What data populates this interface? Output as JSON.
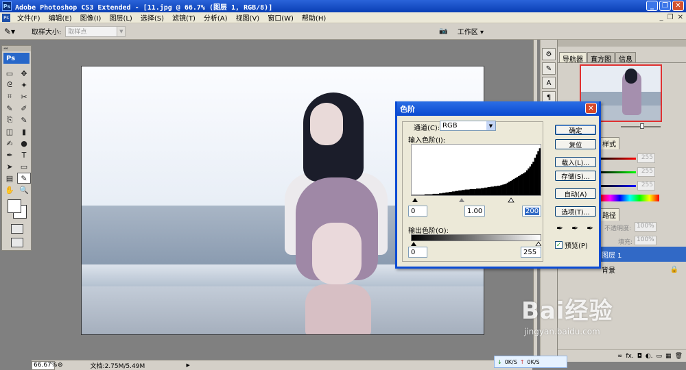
{
  "window": {
    "title": "Adobe Photoshop CS3 Extended - [11.jpg @ 66.7% (图层 1, RGB/8)]",
    "app_badge": "Ps",
    "controls": [
      "_",
      "❐",
      "✕"
    ]
  },
  "menu": {
    "items": [
      "文件(F)",
      "编辑(E)",
      "图像(I)",
      "图层(L)",
      "选择(S)",
      "滤镜(T)",
      "分析(A)",
      "视图(V)",
      "窗口(W)",
      "帮助(H)"
    ],
    "mdi_controls": [
      "_",
      "❐",
      "✕"
    ]
  },
  "options_bar": {
    "sample_size_label": "取样大小:",
    "sample_size_value": "取样点",
    "workspace_label": "工作区 ▾"
  },
  "toolbox": {
    "badge": "Ps",
    "tools": [
      "▭",
      "✥",
      "ᘓ",
      "✦",
      "⌗",
      "✂",
      "✎",
      "✐",
      "⎘",
      "✎",
      "◫",
      "▮",
      "✍",
      "●",
      "✒",
      "T",
      "➤",
      "▭",
      "▤",
      "✎",
      "✋",
      "🔍"
    ]
  },
  "panels": {
    "navigator_tabs": [
      "导航器",
      "直方图",
      "信息"
    ],
    "color_tabs": [
      "样式"
    ],
    "color_values": [
      "255",
      "255",
      "255"
    ],
    "layer_tabs": [
      "路径"
    ],
    "opacity_label": "不透明度:",
    "opacity_value": "100%",
    "fill_label": "填充:",
    "fill_value": "100%",
    "layers": [
      "图层 1",
      "背景"
    ],
    "bottom_icons": [
      "∞",
      "fx.",
      "◘",
      "◐.",
      "▭",
      "▦",
      "🗑"
    ]
  },
  "status": {
    "zoom": "66.67%",
    "doc": "文档:2.75M/5.49M",
    "net_down": "0K/S",
    "net_up": "0K/S"
  },
  "watermark": {
    "main": "Bai经验",
    "sub": "jingyan.baidu.com"
  },
  "levels_dialog": {
    "title": "色阶",
    "channel_label": "通道(C):",
    "channel_value": "RGB",
    "input_label": "输入色阶(I):",
    "input_black": "0",
    "input_gamma": "1.00",
    "input_white": "200",
    "output_label": "输出色阶(O):",
    "output_black": "0",
    "output_white": "255",
    "buttons": [
      "确定",
      "复位",
      "载入(L)...",
      "存储(S)...",
      "自动(A)",
      "选项(T)..."
    ],
    "preview_label": "预览(P)",
    "preview_checked": true
  },
  "histogram_data": [
    1,
    1,
    1,
    1,
    1,
    1,
    1,
    1,
    2,
    2,
    2,
    2,
    2,
    3,
    3,
    3,
    3,
    4,
    4,
    5,
    5,
    6,
    6,
    7,
    7,
    8,
    8,
    9,
    9,
    10,
    10,
    11,
    11,
    12,
    12,
    12,
    13,
    13,
    13,
    13,
    14,
    14,
    14,
    15,
    15,
    16,
    16,
    17,
    17,
    18,
    18,
    19,
    19,
    20,
    20,
    21,
    22,
    23,
    24,
    26,
    28,
    30,
    32,
    34,
    36,
    38,
    40,
    42,
    44,
    46,
    48,
    52,
    56,
    60,
    65,
    70,
    78,
    85,
    92,
    98
  ]
}
